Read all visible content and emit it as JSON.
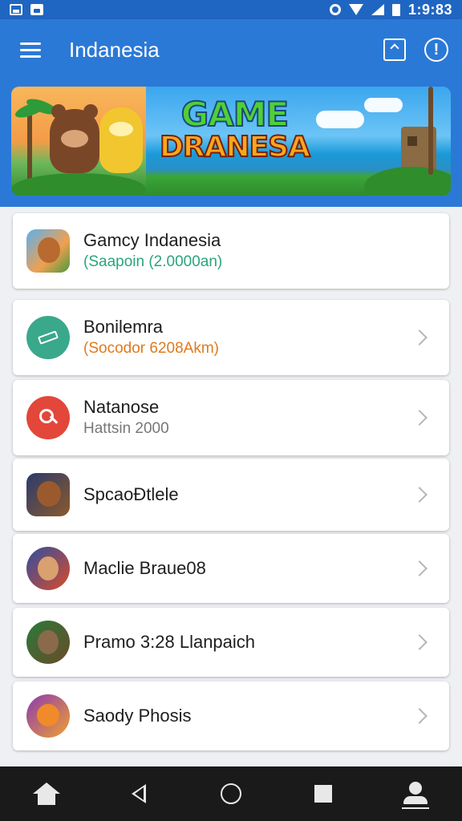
{
  "status_bar": {
    "time": "1:9:83"
  },
  "app_bar": {
    "title": "Indanesia"
  },
  "banner": {
    "line1": "GAME",
    "line2": "DRANESA"
  },
  "list": [
    {
      "title": "Gamcy Indanesia",
      "subtitle": "(Saapoin (2.0000an)",
      "subtitle_color": "#2aa57a",
      "avatar_icon": "fox-game-icon",
      "has_chevron": false
    },
    {
      "title": "Bonilemra",
      "subtitle": "(Socodor 6208Akm)",
      "subtitle_color": "#e07a1c",
      "avatar_icon": "green-compass-icon",
      "has_chevron": true
    },
    {
      "title": "Natanose",
      "subtitle": "Hattsin 2000",
      "subtitle_color": "#777777",
      "avatar_icon": "red-link-icon",
      "has_chevron": true
    },
    {
      "title": "SpcaoÐtlele",
      "subtitle": "",
      "avatar_icon": "bear-game-icon",
      "has_chevron": true
    },
    {
      "title": "Maclie Braue08",
      "subtitle": "",
      "avatar_icon": "warrior-game-icon",
      "has_chevron": true
    },
    {
      "title": "Pramo 3:28 Llanpaich",
      "subtitle": "",
      "avatar_icon": "wolf-game-icon",
      "has_chevron": true
    },
    {
      "title": "Saody Phosis",
      "subtitle": "",
      "avatar_icon": "fox-face-icon",
      "has_chevron": true
    }
  ],
  "colors": {
    "app_bar": "#2b79d6",
    "status_bar": "#1f66c2",
    "nav_bar": "#1a1a1a"
  }
}
